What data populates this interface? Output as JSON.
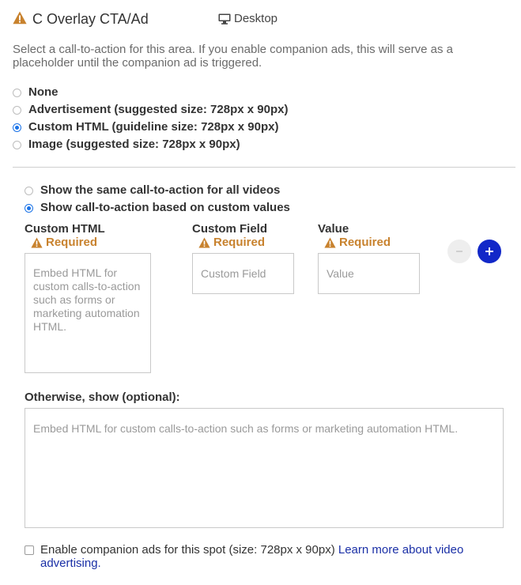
{
  "header": {
    "title": "C Overlay CTA/Ad",
    "device_label": "Desktop"
  },
  "description": "Select a call-to-action for this area. If you enable companion ads, this will serve as a placeholder until the companion ad is triggered.",
  "cta_type": {
    "options": [
      {
        "label": "None",
        "selected": false
      },
      {
        "label": "Advertisement (suggested size: 728px x 90px)",
        "selected": false
      },
      {
        "label": "Custom HTML (guideline size: 728px x 90px)",
        "selected": true
      },
      {
        "label": "Image (suggested size: 728px x 90px)",
        "selected": false
      }
    ]
  },
  "display_mode": {
    "options": [
      {
        "label": "Show the same call-to-action for all videos",
        "selected": false
      },
      {
        "label": "Show call-to-action based on custom values",
        "selected": true
      }
    ]
  },
  "rule_columns": {
    "custom_html": {
      "label": "Custom HTML",
      "required": "Required",
      "placeholder": "Embed HTML for custom calls-to-action such as forms or marketing automation HTML.",
      "value": ""
    },
    "custom_field": {
      "label": "Custom Field",
      "required": "Required",
      "placeholder": "Custom Field",
      "value": ""
    },
    "value": {
      "label": "Value",
      "required": "Required",
      "placeholder": "Value",
      "value": ""
    }
  },
  "otherwise": {
    "label": "Otherwise, show (optional):",
    "placeholder": "Embed HTML for custom calls-to-action such as forms or marketing automation HTML.",
    "value": ""
  },
  "companion": {
    "checked": false,
    "text": "Enable companion ads for this spot (size: 728px x 90px) ",
    "link_text": "Learn more about video advertising."
  },
  "icons": {
    "warning": "warning-triangle-icon",
    "device": "monitor-icon",
    "remove": "minus-icon",
    "add": "plus-icon"
  },
  "colors": {
    "warning": "#c8822e",
    "radio_selected": "#1a73e8",
    "add_button": "#1228c8",
    "link": "#1a2fa6"
  }
}
